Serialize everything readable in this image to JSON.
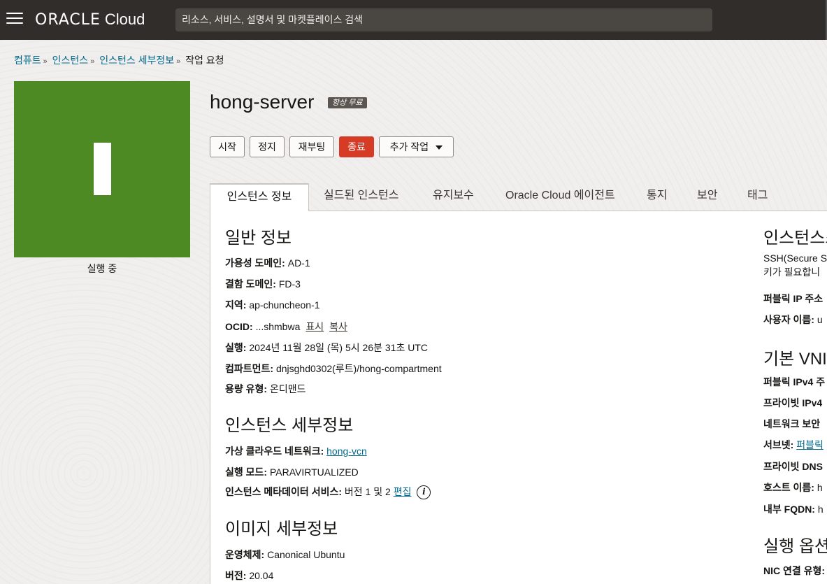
{
  "header": {
    "brand": "ORACLE",
    "product": "Cloud",
    "search_placeholder": "리소스, 서비스, 설명서 및 마켓플레이스 검색"
  },
  "breadcrumb": {
    "items": [
      "컴퓨트",
      "인스턴스",
      "인스턴스 세부정보"
    ],
    "current": "작업 요청"
  },
  "instance": {
    "tile_status": "실행 중",
    "tile_color": "#4d8a23",
    "name": "hong-server",
    "badge": "항상 무료"
  },
  "actions": {
    "start": "시작",
    "stop": "정지",
    "reboot": "재부팅",
    "terminate": "종료",
    "more": "추가 작업"
  },
  "tabs": [
    "인스턴스 정보",
    "실드된 인스턴스",
    "유지보수",
    "Oracle Cloud 에이전트",
    "통지",
    "보안",
    "태그"
  ],
  "general": {
    "heading": "일반 정보",
    "ad_label": "가용성 도메인:",
    "ad_value": "AD-1",
    "fd_label": "결함 도메인:",
    "fd_value": "FD-3",
    "region_label": "지역:",
    "region_value": "ap-chuncheon-1",
    "ocid_label": "OCID:",
    "ocid_value": "...shmbwa",
    "ocid_show": "표시",
    "ocid_copy": "복사",
    "launched_label": "실행:",
    "launched_value": "2024년 11월 28일 (목) 5시 26분 31초 UTC",
    "compartment_label": "컴파트먼트:",
    "compartment_value": "dnjsghd0302(루트)/hong-compartment",
    "capacity_label": "용량 유형:",
    "capacity_value": "온디맨드"
  },
  "details": {
    "heading": "인스턴스 세부정보",
    "vcn_label": "가상 클라우드 네트워크:",
    "vcn_value": "hong-vcn",
    "mode_label": "실행 모드:",
    "mode_value": "PARAVIRTUALIZED",
    "imds_label": "인스턴스 메타데이터 서비스:",
    "imds_value": "버전 1 및 2",
    "imds_edit": "편집"
  },
  "image": {
    "heading": "이미지 세부정보",
    "os_label": "운영체제:",
    "os_value": "Canonical Ubuntu",
    "version_label": "버전:",
    "version_value": "20.04"
  },
  "access": {
    "heading": "인스턴스스",
    "line1": "SSH(Secure S",
    "line2": "키가 필요합니",
    "public_ip_label": "퍼블릭 IP 주소",
    "username_label": "사용자 이름:",
    "username_value": "u"
  },
  "vnic": {
    "heading": "기본 VNI",
    "pub_ipv4": "퍼블릭 IPv4 주",
    "priv_ipv4": "프라이빗 IPv4",
    "nsg": "네트워크 보안",
    "subnet_label": "서브넷:",
    "subnet_value": "퍼블릭",
    "priv_dns": "프라이빗 DNS",
    "hostname_label": "호스트 이름:",
    "hostname_value": "h",
    "fqdn_label": "내부 FQDN:",
    "fqdn_value": "h"
  },
  "launch_options": {
    "heading": "실행 옵션",
    "nic_label": "NIC 연결 유형:"
  }
}
